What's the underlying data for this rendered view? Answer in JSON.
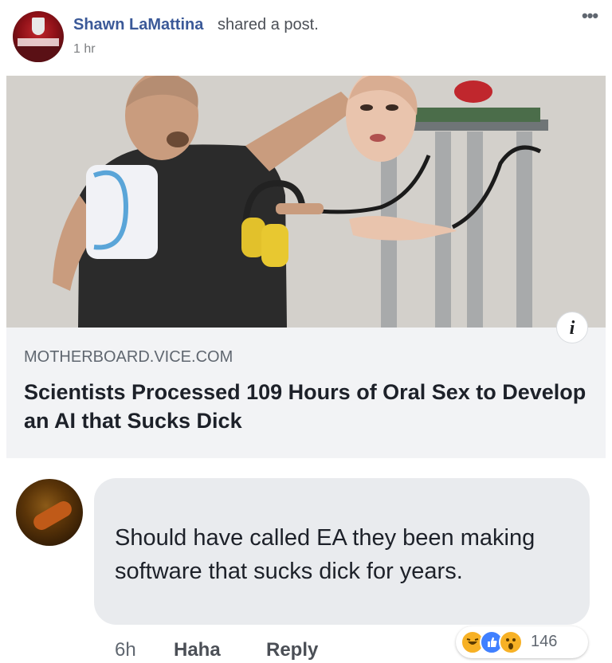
{
  "post": {
    "author": "Shawn LaMattina",
    "action": "shared a post.",
    "time": "1 hr",
    "more_icon": "more-horizontal-icon"
  },
  "link": {
    "domain": "MOTHERBOARD.VICE.COM",
    "title": "Scientists Processed 109 Hours of Oral Sex to Develop an AI that Sucks Dick",
    "info_glyph": "i"
  },
  "comment": {
    "text": "Should have called EA they been making software that sucks dick for years.",
    "time": "6h",
    "haha_label": "Haha",
    "reply_label": "Reply",
    "reaction_count": "146",
    "reaction_icons": [
      "haha-icon",
      "like-icon",
      "wow-icon"
    ]
  },
  "colors": {
    "link_blue": "#3b5998",
    "reaction_like": "#4080ff",
    "reaction_haha": "#f7b125",
    "bubble": "#e9ebee"
  }
}
